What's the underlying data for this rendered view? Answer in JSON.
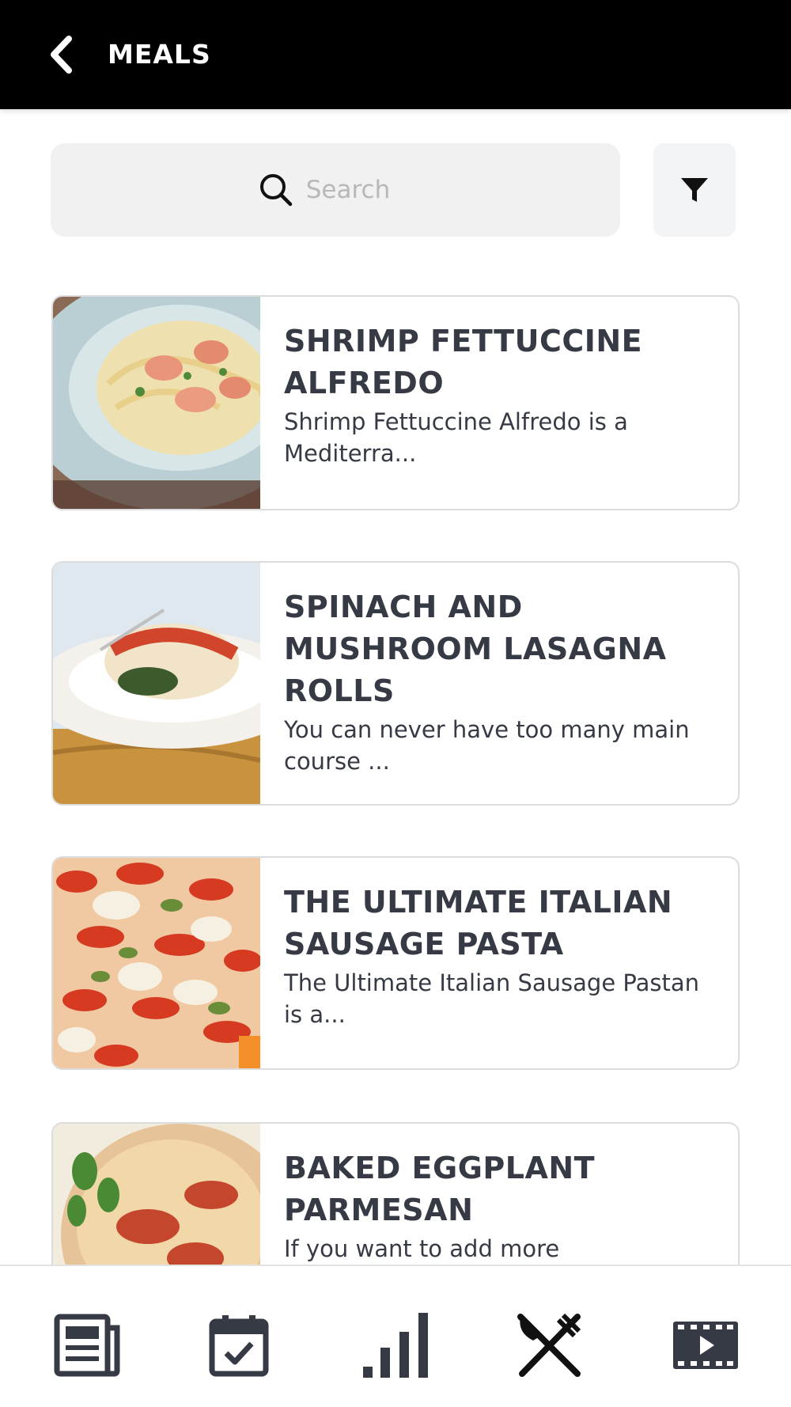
{
  "header": {
    "title": "MEALS"
  },
  "search": {
    "placeholder": "Search"
  },
  "meals": [
    {
      "title": "SHRIMP FETTUCCINE ALFREDO",
      "description": "Shrimp Fettuccine Alfredo is a Mediterra..."
    },
    {
      "title": "SPINACH AND MUSHROOM LASAGNA ROLLS",
      "description": "You can never have too many main course ..."
    },
    {
      "title": "THE ULTIMATE ITALIAN SAUSAGE PASTA",
      "description": "The Ultimate Italian Sausage Pastan is a..."
    },
    {
      "title": "BAKED EGGPLANT PARMESAN",
      "description": "If you want to add more"
    }
  ],
  "bottom_nav": [
    {
      "icon": "news-icon"
    },
    {
      "icon": "calendar-check-icon"
    },
    {
      "icon": "bar-chart-icon"
    },
    {
      "icon": "fork-knife-icon",
      "active": true
    },
    {
      "icon": "video-icon"
    }
  ],
  "colors": {
    "header_bg": "#000000",
    "text_dark": "#363a45",
    "search_bg": "#f1f1f1"
  }
}
